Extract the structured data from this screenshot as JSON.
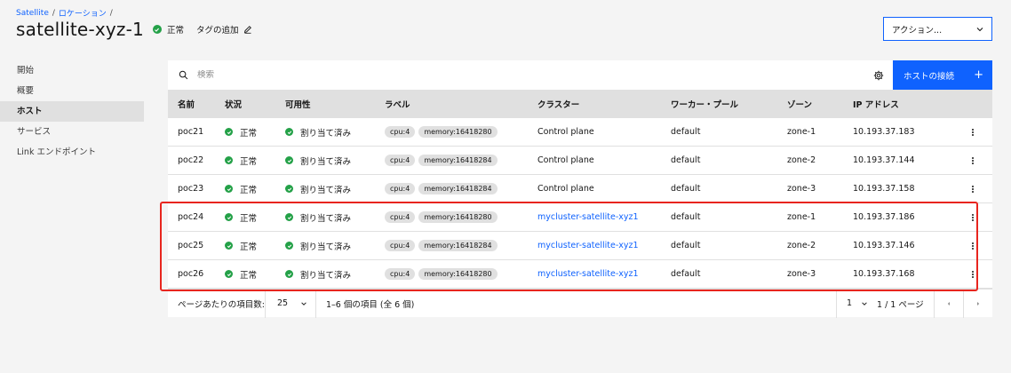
{
  "breadcrumb": {
    "satellite": "Satellite",
    "sep1": "/",
    "locations": "ロケーション",
    "sep2": "/"
  },
  "header": {
    "title": "satellite-xyz-1",
    "status": "正常",
    "add_tag": "タグの追加",
    "actions": "アクション..."
  },
  "sidebar": {
    "items": [
      {
        "label": "開始"
      },
      {
        "label": "概要"
      },
      {
        "label": "ホスト",
        "active": true
      },
      {
        "label": "サービス"
      },
      {
        "label": "Link エンドポイント"
      }
    ]
  },
  "toolbar": {
    "search_placeholder": "検索",
    "connect_label": "ホストの接続",
    "connect_plus": "+"
  },
  "table": {
    "headers": {
      "name": "名前",
      "status": "状況",
      "availability": "可用性",
      "labels": "ラベル",
      "cluster": "クラスター",
      "worker_pool": "ワーカー・プール",
      "zone": "ゾーン",
      "ip": "IP アドレス"
    },
    "rows": [
      {
        "name": "poc21",
        "status": "正常",
        "availability": "割り当て済み",
        "label_cpu": "cpu:4",
        "label_mem": "memory:16418280",
        "cluster": "Control plane",
        "cluster_link": false,
        "pool": "default",
        "zone": "zone-1",
        "ip": "10.193.37.183"
      },
      {
        "name": "poc22",
        "status": "正常",
        "availability": "割り当て済み",
        "label_cpu": "cpu:4",
        "label_mem": "memory:16418284",
        "cluster": "Control plane",
        "cluster_link": false,
        "pool": "default",
        "zone": "zone-2",
        "ip": "10.193.37.144"
      },
      {
        "name": "poc23",
        "status": "正常",
        "availability": "割り当て済み",
        "label_cpu": "cpu:4",
        "label_mem": "memory:16418284",
        "cluster": "Control plane",
        "cluster_link": false,
        "pool": "default",
        "zone": "zone-3",
        "ip": "10.193.37.158"
      },
      {
        "name": "poc24",
        "status": "正常",
        "availability": "割り当て済み",
        "label_cpu": "cpu:4",
        "label_mem": "memory:16418280",
        "cluster": "mycluster-satellite-xyz1",
        "cluster_link": true,
        "pool": "default",
        "zone": "zone-1",
        "ip": "10.193.37.186"
      },
      {
        "name": "poc25",
        "status": "正常",
        "availability": "割り当て済み",
        "label_cpu": "cpu:4",
        "label_mem": "memory:16418284",
        "cluster": "mycluster-satellite-xyz1",
        "cluster_link": true,
        "pool": "default",
        "zone": "zone-2",
        "ip": "10.193.37.146"
      },
      {
        "name": "poc26",
        "status": "正常",
        "availability": "割り当て済み",
        "label_cpu": "cpu:4",
        "label_mem": "memory:16418280",
        "cluster": "mycluster-satellite-xyz1",
        "cluster_link": true,
        "pool": "default",
        "zone": "zone-3",
        "ip": "10.193.37.168"
      }
    ]
  },
  "pagination": {
    "per_page_label": "ページあたりの項目数:",
    "per_page_value": "25",
    "range": "1–6 個の項目 (全 6 個)",
    "page_value": "1",
    "page_of": "1 / 1 ページ"
  },
  "colors": {
    "accent": "#0f62fe",
    "success": "#24a148",
    "highlight": "#e8251e"
  }
}
